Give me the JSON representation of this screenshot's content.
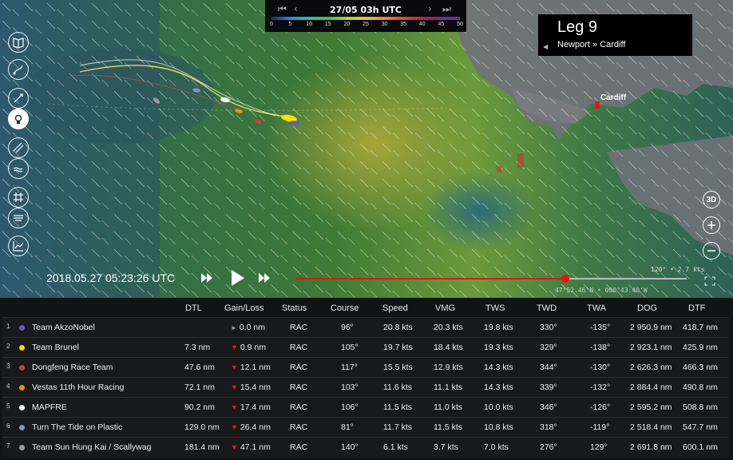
{
  "map": {
    "timebar": {
      "date": "27/05 03h UTC",
      "first_icon": "skip-first-icon",
      "prev_icon": "prev-icon",
      "next_icon": "next-icon",
      "last_icon": "skip-last-icon",
      "scale_ticks": [
        "0",
        "5",
        "10",
        "15",
        "20",
        "25",
        "30",
        "35",
        "40",
        "45",
        "50"
      ]
    },
    "leg": {
      "title": "Leg 9",
      "subtitle": "Newport » Cardiff",
      "collapse_icon": "caret-left-icon"
    },
    "city": "Cardiff",
    "tools": [
      "book-icon",
      "route-icon",
      "wind-barb-icon",
      "camera-icon",
      "stream-icon",
      "flag-icon",
      "grid-icon",
      "legend-icon",
      "chart-icon"
    ],
    "right_buttons": {
      "three_d": "3D",
      "zoom_in_icon": "plus-icon",
      "zoom_out_icon": "minus-icon"
    },
    "playback": {
      "datetime": "2018.05.27 05:23:26 UTC",
      "rewind_icon": "rewind-icon",
      "play_icon": "play-icon",
      "forward_icon": "fast-forward-icon",
      "progress": 0.69
    },
    "coords": "47°52.46'N • 000°43.40'W",
    "wind_readout": "120° • 2.7 kts",
    "expand_icon": "fullscreen-icon"
  },
  "table": {
    "headers": [
      "DTL",
      "Gain/Loss",
      "Status",
      "Course",
      "Speed",
      "VMG",
      "TWS",
      "TWD",
      "TWA",
      "DOG",
      "DTF"
    ],
    "rows": [
      {
        "rank": "1",
        "team": "Team AkzoNobel",
        "color": "#7a4fc9",
        "dtl": "",
        "gain_dir": "same",
        "gain": "0.0 nm",
        "status": "RAC",
        "course": "96°",
        "speed": "20.8 kts",
        "vmg": "20.3 kts",
        "tws": "19.8 kts",
        "twd": "330°",
        "twa": "-135°",
        "dog": "2 950.9 nm",
        "dtf": "418.7 nm"
      },
      {
        "rank": "2",
        "team": "Team Brunel",
        "color": "#f2e200",
        "dtl": "7.3 nm",
        "gain_dir": "down",
        "gain": "0.9 nm",
        "status": "RAC",
        "course": "105°",
        "speed": "19.7 kts",
        "vmg": "18.4 kts",
        "tws": "19.3 kts",
        "twd": "329°",
        "twa": "-138°",
        "dog": "2 923.1 nm",
        "dtf": "425.9 nm"
      },
      {
        "rank": "3",
        "team": "Dongfeng Race Team",
        "color": "#d23a3a",
        "dtl": "47.6 nm",
        "gain_dir": "down",
        "gain": "12.1 nm",
        "status": "RAC",
        "course": "117°",
        "speed": "15.5 kts",
        "vmg": "12.9 kts",
        "tws": "14.3 kts",
        "twd": "344°",
        "twa": "-130°",
        "dog": "2 626.3 nm",
        "dtf": "466.3 nm"
      },
      {
        "rank": "4",
        "team": "Vestas 11th Hour Racing",
        "color": "#f08a1d",
        "dtl": "72.1 nm",
        "gain_dir": "down",
        "gain": "15.4 nm",
        "status": "RAC",
        "course": "103°",
        "speed": "11.6 kts",
        "vmg": "11.1 kts",
        "tws": "14.3 kts",
        "twd": "339°",
        "twa": "-132°",
        "dog": "2 884.4 nm",
        "dtf": "490.8 nm"
      },
      {
        "rank": "5",
        "team": "MAPFRE",
        "color": "#ffffff",
        "dtl": "90.2 nm",
        "gain_dir": "down",
        "gain": "17.4 nm",
        "status": "RAC",
        "course": "106°",
        "speed": "11.5 kts",
        "vmg": "11.0 kts",
        "tws": "10.0 kts",
        "twd": "346°",
        "twa": "-126°",
        "dog": "2 595.2 nm",
        "dtf": "508.8 nm"
      },
      {
        "rank": "6",
        "team": "Turn The Tide on Plastic",
        "color": "#7f8fd6",
        "dtl": "129.0 nm",
        "gain_dir": "down",
        "gain": "26.4 nm",
        "status": "RAC",
        "course": "81°",
        "speed": "11.7 kts",
        "vmg": "11.5 kts",
        "tws": "10.8 kts",
        "twd": "318°",
        "twa": "-119°",
        "dog": "2 518.4 nm",
        "dtf": "547.7 nm"
      },
      {
        "rank": "7",
        "team": "Team Sun Hung Kai / Scallywag",
        "color": "#9a9a9a",
        "dtl": "181.4 nm",
        "gain_dir": "down",
        "gain": "47.1 nm",
        "status": "RAC",
        "course": "140°",
        "speed": "6.1 kts",
        "vmg": "3.7 kts",
        "tws": "7.0 kts",
        "twd": "276°",
        "twa": "129°",
        "dog": "2 691.8 nm",
        "dtf": "600.1 nm"
      }
    ]
  }
}
